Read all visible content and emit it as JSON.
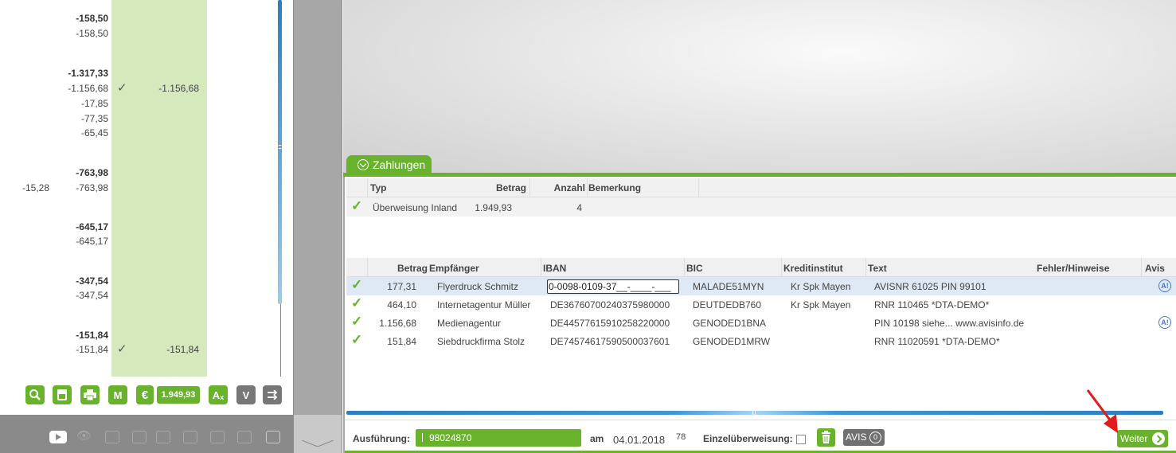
{
  "left_panel": {
    "rows": [
      {
        "col1": "-158,50",
        "bold": true
      },
      {
        "col1": "-158,50"
      },
      {
        "col1": "-1.317,33",
        "bold": true
      },
      {
        "col1": "-1.156,68",
        "check": true,
        "col3": "-1.156,68"
      },
      {
        "col1": "-17,85"
      },
      {
        "col1": "-77,35"
      },
      {
        "col1": "-65,45"
      },
      {
        "col1": "-763,98",
        "bold": true
      },
      {
        "col0": "-15,28",
        "col1": "-763,98"
      },
      {
        "col1": "-645,17",
        "bold": true
      },
      {
        "col1": "-645,17"
      },
      {
        "col1": "-347,54",
        "bold": true
      },
      {
        "col1": "-347,54"
      },
      {
        "col1": "-151,84",
        "bold": true
      },
      {
        "col1": "-151,84",
        "check": true,
        "col3": "-151,84"
      }
    ],
    "toolbar": {
      "search_icon": "magnifier-icon",
      "doc_icon": "document-icon",
      "print_icon": "printer-icon",
      "m_label": "M",
      "euro_label": "€",
      "amount_label": "1.949,93",
      "ax_label": "A",
      "v_label": "V",
      "transfer_icon": "transfer-icon"
    }
  },
  "tab": {
    "label": "Zahlungen"
  },
  "summary": {
    "headers": {
      "typ": "Typ",
      "betrag": "Betrag",
      "anzahl": "Anzahl",
      "bemerkung": "Bemerkung"
    },
    "row": {
      "typ": "Überweisung Inland",
      "betrag": "1.949,93",
      "anzahl": "4"
    }
  },
  "details": {
    "headers": {
      "betrag": "Betrag",
      "empfaenger": "Empfänger",
      "iban": "IBAN",
      "bic": "BIC",
      "kreditinstitut": "Kreditinstitut",
      "text": "Text",
      "fehler": "Fehler/Hinweise",
      "avis": "Avis"
    },
    "rows": [
      {
        "betrag": "177,31",
        "empfaenger": "Flyerdruck Schmitz",
        "iban": "0-0098-0109-37__-____-___",
        "bic": "MALADE51MYN",
        "kreditinstitut": "Kr Spk Mayen",
        "text": "AVISNR 61025 PIN 99101",
        "avis": "A!"
      },
      {
        "betrag": "464,10",
        "empfaenger": "Internetagentur Müller",
        "iban": "DE36760700240375980000",
        "bic": "DEUTDEDB760",
        "kreditinstitut": "Kr Spk Mayen",
        "text": "RNR 110465 *DTA-DEMO*",
        "avis": ""
      },
      {
        "betrag": "1.156,68",
        "empfaenger": "Medienagentur",
        "iban": "DE44577615910258220000",
        "bic": "GENODED1BNA",
        "kreditinstitut": "",
        "text": "PIN 10198 siehe... www.avisinfo.de",
        "avis": "A!"
      },
      {
        "betrag": "151,84",
        "empfaenger": "Siebdruckfirma Stolz",
        "iban": "DE74574617590500037601",
        "bic": "GENODED1MRW",
        "kreditinstitut": "",
        "text": "RNR 11020591 *DTA-DEMO*",
        "avis": ""
      }
    ]
  },
  "bottom": {
    "ausfuehrung_label": "Ausführung:",
    "ausfuehrung_value": "98024870",
    "am_label": "am",
    "date": "04.01.2018",
    "cal_label": "78",
    "einzel_label": "Einzelüberweisung:",
    "avis_label": "AVIS",
    "avis_count": "0",
    "weiter_label": "Weiter"
  },
  "colors": {
    "accent": "#68b22c",
    "blue": "#2a7fc1",
    "grey": "#a7a7a7"
  }
}
